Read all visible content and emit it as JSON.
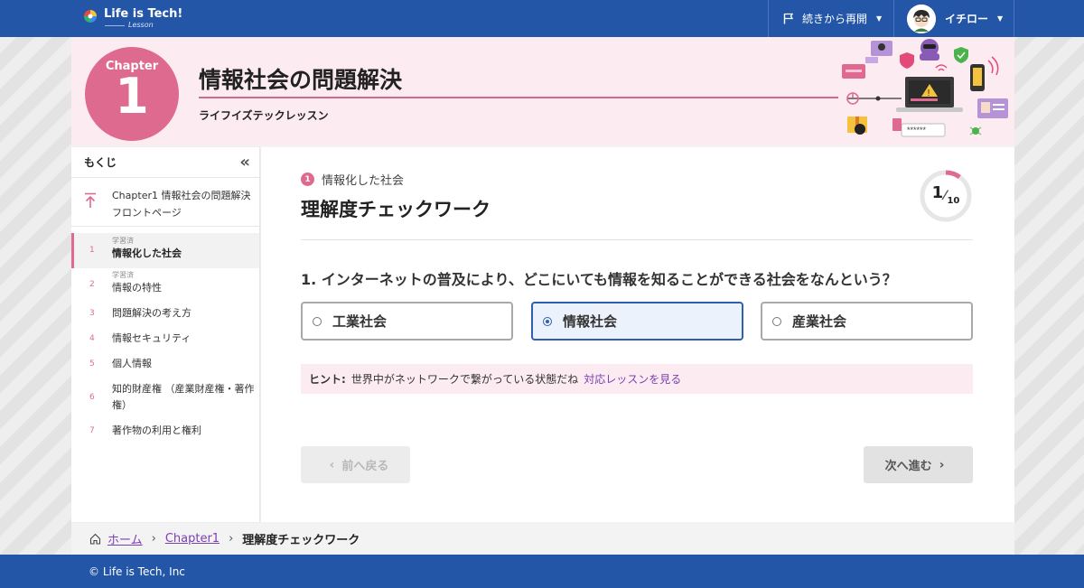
{
  "header": {
    "logo_text": "Life is Tech!",
    "logo_sub": "Lesson",
    "resume_label": "続きから再開",
    "user_name": "イチロー"
  },
  "chapter": {
    "label": "Chapter",
    "number": "1",
    "title": "情報社会の問題解決",
    "subtitle": "ライフイズテックレッスン"
  },
  "sidebar": {
    "heading": "もくじ",
    "front_line1": "Chapter1 情報社会の問題解決",
    "front_line2": "フロントページ",
    "items": [
      {
        "num": "1",
        "tag": "学習済",
        "label": "情報化した社会"
      },
      {
        "num": "2",
        "tag": "学習済",
        "label": "情報の特性"
      },
      {
        "num": "3",
        "tag": "",
        "label": "問題解決の考え方"
      },
      {
        "num": "4",
        "tag": "",
        "label": "情報セキュリティ"
      },
      {
        "num": "5",
        "tag": "",
        "label": "個人情報"
      },
      {
        "num": "6",
        "tag": "",
        "label": "知的財産権 （産業財産権・著作権）"
      },
      {
        "num": "7",
        "tag": "",
        "label": "著作物の利用と権利"
      }
    ]
  },
  "main": {
    "section_num": "1",
    "section_title": "情報化した社会",
    "work_title": "理解度チェックワーク",
    "progress_current": "1",
    "progress_total": "10",
    "progress_fraction": 0.1,
    "question": "1. インターネットの普及により、どこにいても情報を知ることができる社会をなんという？",
    "options": [
      {
        "label": "工業社会",
        "selected": false
      },
      {
        "label": "情報社会",
        "selected": true
      },
      {
        "label": "産業社会",
        "selected": false
      }
    ],
    "hint_key": "ヒント:",
    "hint_text": "世界中がネットワークで繋がっている状態だね",
    "hint_link": "対応レッスンを見る",
    "prev_label": "前へ戻る",
    "next_label": "次へ進む"
  },
  "breadcrumb": {
    "home": "ホーム",
    "chapter": "Chapter1",
    "current": "理解度チェックワーク"
  },
  "footer": {
    "copyright": "© Life is Tech, Inc"
  },
  "colors": {
    "header_blue": "#2456a8",
    "accent_pink": "#de6a8f",
    "selected_blue": "#2f5fad",
    "link_purple": "#7a3fb3"
  }
}
